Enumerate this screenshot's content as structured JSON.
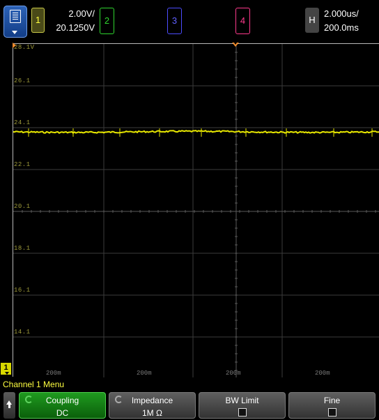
{
  "channels": {
    "ch1": {
      "number": "1",
      "scale": "2.00V/",
      "offset": "20.1250V",
      "color": "#ffff40"
    },
    "ch2": {
      "number": "2",
      "color": "#2fd62f"
    },
    "ch3": {
      "number": "3",
      "color": "#6060ff"
    },
    "ch4": {
      "number": "4",
      "color": "#ff3a8c"
    }
  },
  "horizontal": {
    "label": "H",
    "time_per_div": "2.000us/",
    "delay": "200.0ms"
  },
  "display": {
    "voltage_labels": [
      "28.1V",
      "26.1",
      "24.1",
      "22.1",
      "20.1",
      "18.1",
      "16.1",
      "14.1"
    ],
    "time_labels": [
      "200m",
      "200m",
      "200m",
      "200m"
    ],
    "ground_marker": "1",
    "trace_color": "#e8e800",
    "trace_level_volts": 23.9
  },
  "menu": {
    "title": "Channel 1 Menu",
    "softkeys": [
      {
        "label": "Coupling",
        "value": "DC"
      },
      {
        "label": "Impedance",
        "value": "1M Ω"
      },
      {
        "label": "BW Limit",
        "checked": false
      },
      {
        "label": "Fine",
        "checked": false
      }
    ]
  }
}
